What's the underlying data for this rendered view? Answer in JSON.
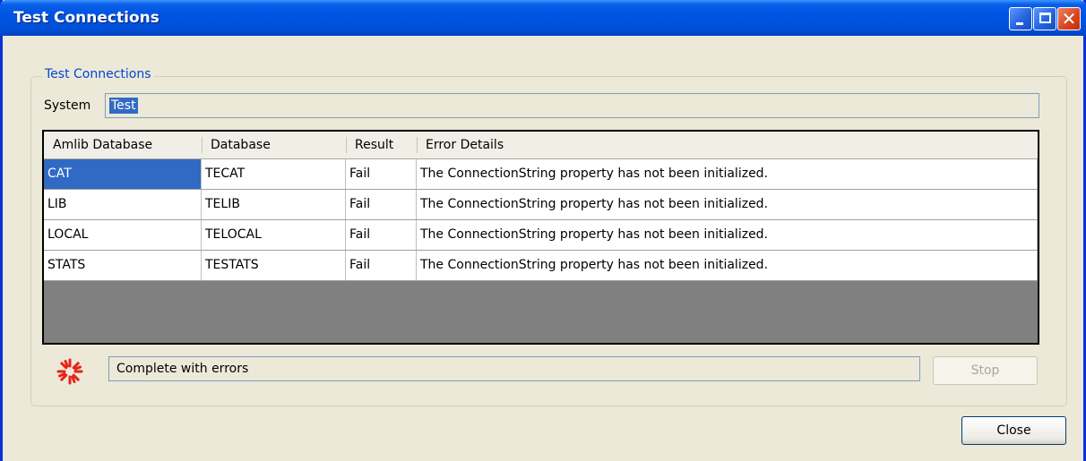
{
  "window": {
    "title": "Test Connections"
  },
  "group": {
    "title": "Test Connections"
  },
  "system": {
    "label": "System",
    "value": "Test"
  },
  "grid": {
    "columns": [
      "Amlib Database",
      "Database",
      "Result",
      "Error Details"
    ],
    "rows": [
      [
        "CAT",
        "TECAT",
        "Fail",
        "The ConnectionString property has not been initialized."
      ],
      [
        "LIB",
        "TELIB",
        "Fail",
        "The ConnectionString property has not been initialized."
      ],
      [
        "LOCAL",
        "TELOCAL",
        "Fail",
        "The ConnectionString property has not been initialized."
      ],
      [
        "STATS",
        "TESTATS",
        "Fail",
        "The ConnectionString property has not been initialized."
      ]
    ]
  },
  "status": {
    "text": "Complete with errors",
    "icon": "spinner-icon"
  },
  "buttons": {
    "stop": "Stop",
    "close": "Close"
  },
  "colors": {
    "titlebar": "#0054e3",
    "selection": "#316ac5",
    "spinner": "#e8231a",
    "grid_empty": "#808080"
  }
}
